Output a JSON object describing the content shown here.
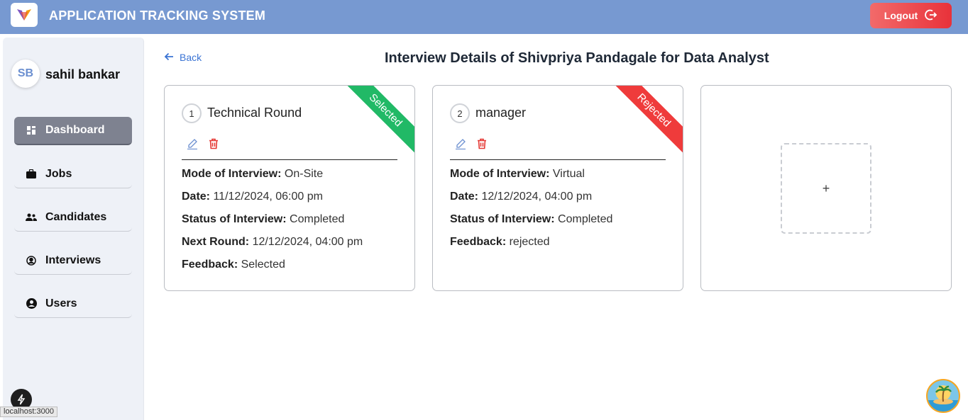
{
  "header": {
    "title": "APPLICATION TRACKING SYSTEM",
    "logout_label": "Logout",
    "logo_icon": "app-logo-icon",
    "color": "#7799d1"
  },
  "sidebar": {
    "initials": "SB",
    "username": "sahil bankar",
    "items": [
      {
        "label": "Dashboard",
        "icon": "dashboard-icon",
        "active": true
      },
      {
        "label": "Jobs",
        "icon": "briefcase-icon",
        "active": false
      },
      {
        "label": "Candidates",
        "icon": "people-icon",
        "active": false
      },
      {
        "label": "Interviews",
        "icon": "interview-icon",
        "active": false
      },
      {
        "label": "Users",
        "icon": "user-circle-icon",
        "active": false
      }
    ]
  },
  "main": {
    "back_label": "Back",
    "page_title": "Interview Details of Shivpriya Pandagale for Data Analyst",
    "rounds": [
      {
        "number": "1",
        "name": "Technical Round",
        "status_ribbon": "Selected",
        "ribbon_color": "#21b966",
        "fields": [
          {
            "label": "Mode of Interview:",
            "value": "On-Site"
          },
          {
            "label": "Date:",
            "value": "11/12/2024, 06:00 pm"
          },
          {
            "label": "Status of Interview:",
            "value": "Completed"
          },
          {
            "label": "Next Round:",
            "value": "12/12/2024, 04:00 pm"
          },
          {
            "label": "Feedback:",
            "value": "Selected"
          }
        ]
      },
      {
        "number": "2",
        "name": "manager",
        "status_ribbon": "Rejected",
        "ribbon_color": "#ef3b3b",
        "fields": [
          {
            "label": "Mode of Interview:",
            "value": "Virtual"
          },
          {
            "label": "Date:",
            "value": "12/12/2024, 04:00 pm"
          },
          {
            "label": "Status of Interview:",
            "value": "Completed"
          },
          {
            "label": "Feedback:",
            "value": "rejected"
          }
        ]
      }
    ],
    "add_round_label": "+"
  },
  "status_bar": {
    "url": "localhost:3000"
  }
}
